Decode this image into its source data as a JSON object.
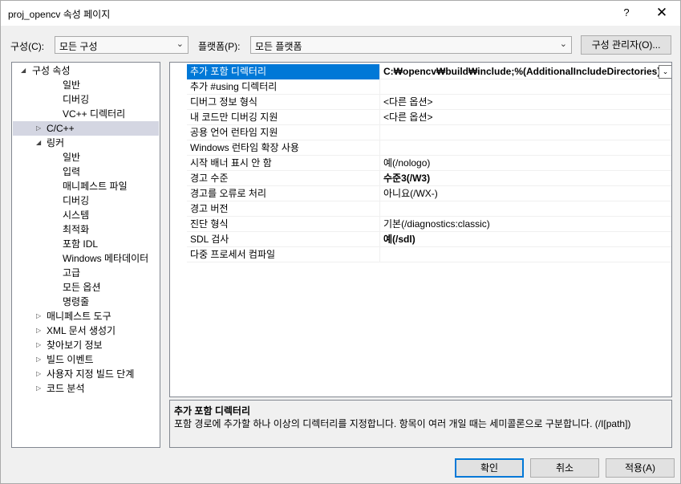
{
  "window": {
    "title": "proj_opencv 속성 페이지",
    "help_glyph": "?",
    "close_glyph": "✕"
  },
  "toolbar": {
    "config_label": "구성(C):",
    "config_value": "모든 구성",
    "platform_label": "플랫폼(P):",
    "platform_value": "모든 플랫폼",
    "config_manager": "구성 관리자(O)..."
  },
  "tree": {
    "items": [
      {
        "label": "구성 속성",
        "expander": "◢",
        "selected": false
      },
      {
        "label": "일반",
        "expander": "",
        "selected": false
      },
      {
        "label": "디버깅",
        "expander": "",
        "selected": false
      },
      {
        "label": "VC++ 디렉터리",
        "expander": "",
        "selected": false
      },
      {
        "label": "C/C++",
        "expander": "▷",
        "selected": true
      },
      {
        "label": "링커",
        "expander": "◢",
        "selected": false
      },
      {
        "label": "일반",
        "expander": "",
        "selected": false
      },
      {
        "label": "입력",
        "expander": "",
        "selected": false
      },
      {
        "label": "매니페스트 파일",
        "expander": "",
        "selected": false
      },
      {
        "label": "디버깅",
        "expander": "",
        "selected": false
      },
      {
        "label": "시스템",
        "expander": "",
        "selected": false
      },
      {
        "label": "최적화",
        "expander": "",
        "selected": false
      },
      {
        "label": "포함 IDL",
        "expander": "",
        "selected": false
      },
      {
        "label": "Windows 메타데이터",
        "expander": "",
        "selected": false
      },
      {
        "label": "고급",
        "expander": "",
        "selected": false
      },
      {
        "label": "모든 옵션",
        "expander": "",
        "selected": false
      },
      {
        "label": "명령줄",
        "expander": "",
        "selected": false
      },
      {
        "label": "매니페스트 도구",
        "expander": "▷",
        "selected": false
      },
      {
        "label": "XML 문서 생성기",
        "expander": "▷",
        "selected": false
      },
      {
        "label": "찾아보기 정보",
        "expander": "▷",
        "selected": false
      },
      {
        "label": "빌드 이벤트",
        "expander": "▷",
        "selected": false
      },
      {
        "label": "사용자 지정 빌드 단계",
        "expander": "▷",
        "selected": false
      },
      {
        "label": "코드 분석",
        "expander": "▷",
        "selected": false
      }
    ]
  },
  "properties": [
    {
      "name": "추가 포함 디렉터리",
      "value": "C:₩opencv₩build₩include;%(AdditionalIncludeDirectories)",
      "bold": true
    },
    {
      "name": "추가 #using 디렉터리",
      "value": "",
      "bold": false
    },
    {
      "name": "디버그 정보 형식",
      "value": "<다른 옵션>",
      "bold": false
    },
    {
      "name": "내 코드만 디버깅 지원",
      "value": "<다른 옵션>",
      "bold": false
    },
    {
      "name": "공용 언어 런타임 지원",
      "value": "",
      "bold": false
    },
    {
      "name": "Windows 런타임 확장 사용",
      "value": "",
      "bold": false
    },
    {
      "name": "시작 배너 표시 안 함",
      "value": "예(/nologo)",
      "bold": false
    },
    {
      "name": "경고 수준",
      "value": "수준3(/W3)",
      "bold": true
    },
    {
      "name": "경고를 오류로 처리",
      "value": "아니요(/WX-)",
      "bold": false
    },
    {
      "name": "경고 버전",
      "value": "",
      "bold": false
    },
    {
      "name": "진단 형식",
      "value": "기본(/diagnostics:classic)",
      "bold": false
    },
    {
      "name": "SDL 검사",
      "value": "예(/sdl)",
      "bold": true
    },
    {
      "name": "다중 프로세서 컴파일",
      "value": "",
      "bold": false
    }
  ],
  "description": {
    "title": "추가 포함 디렉터리",
    "text": "포함 경로에 추가할 하나 이상의 디렉터리를 지정합니다. 항목이 여러 개일 때는 세미콜론으로 구분합니다. (/I[path])"
  },
  "buttons": {
    "ok": "확인",
    "cancel": "취소",
    "apply": "적용(A)"
  },
  "colors": {
    "selection": "#0078d7",
    "tree_selection": "#d4d6e2"
  }
}
